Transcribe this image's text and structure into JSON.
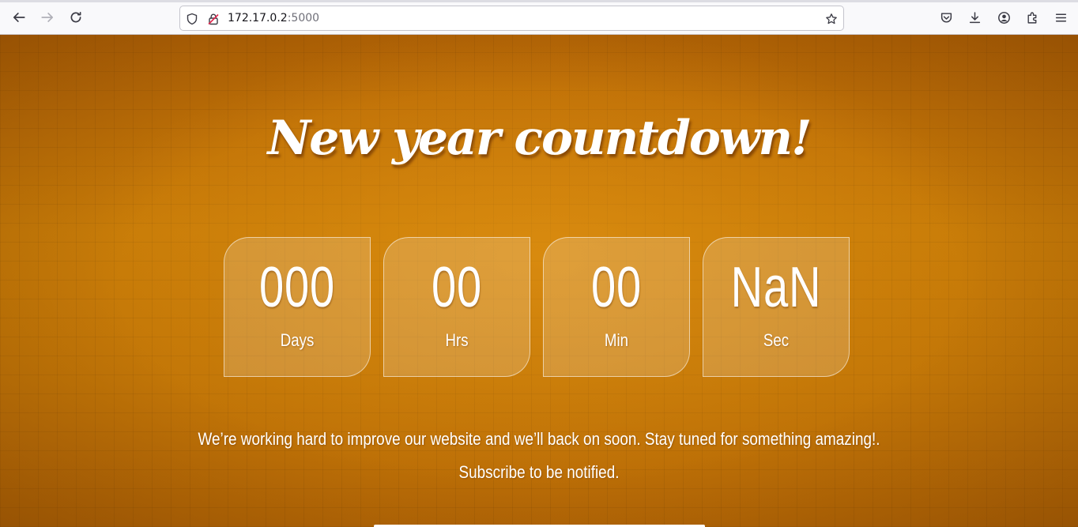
{
  "browser": {
    "url_host": "172.17.0.2",
    "url_port": ":5000"
  },
  "page": {
    "title": "New year countdown!",
    "countdown": [
      {
        "value": "000",
        "label": "Days"
      },
      {
        "value": "00",
        "label": "Hrs"
      },
      {
        "value": "00",
        "label": "Min"
      },
      {
        "value": "NaN",
        "label": "Sec"
      }
    ],
    "message_line1": "We’re working hard to improve our website and we’ll back on soon. Stay tuned for something amazing!.",
    "message_line2": "Subscribe to be notified."
  }
}
